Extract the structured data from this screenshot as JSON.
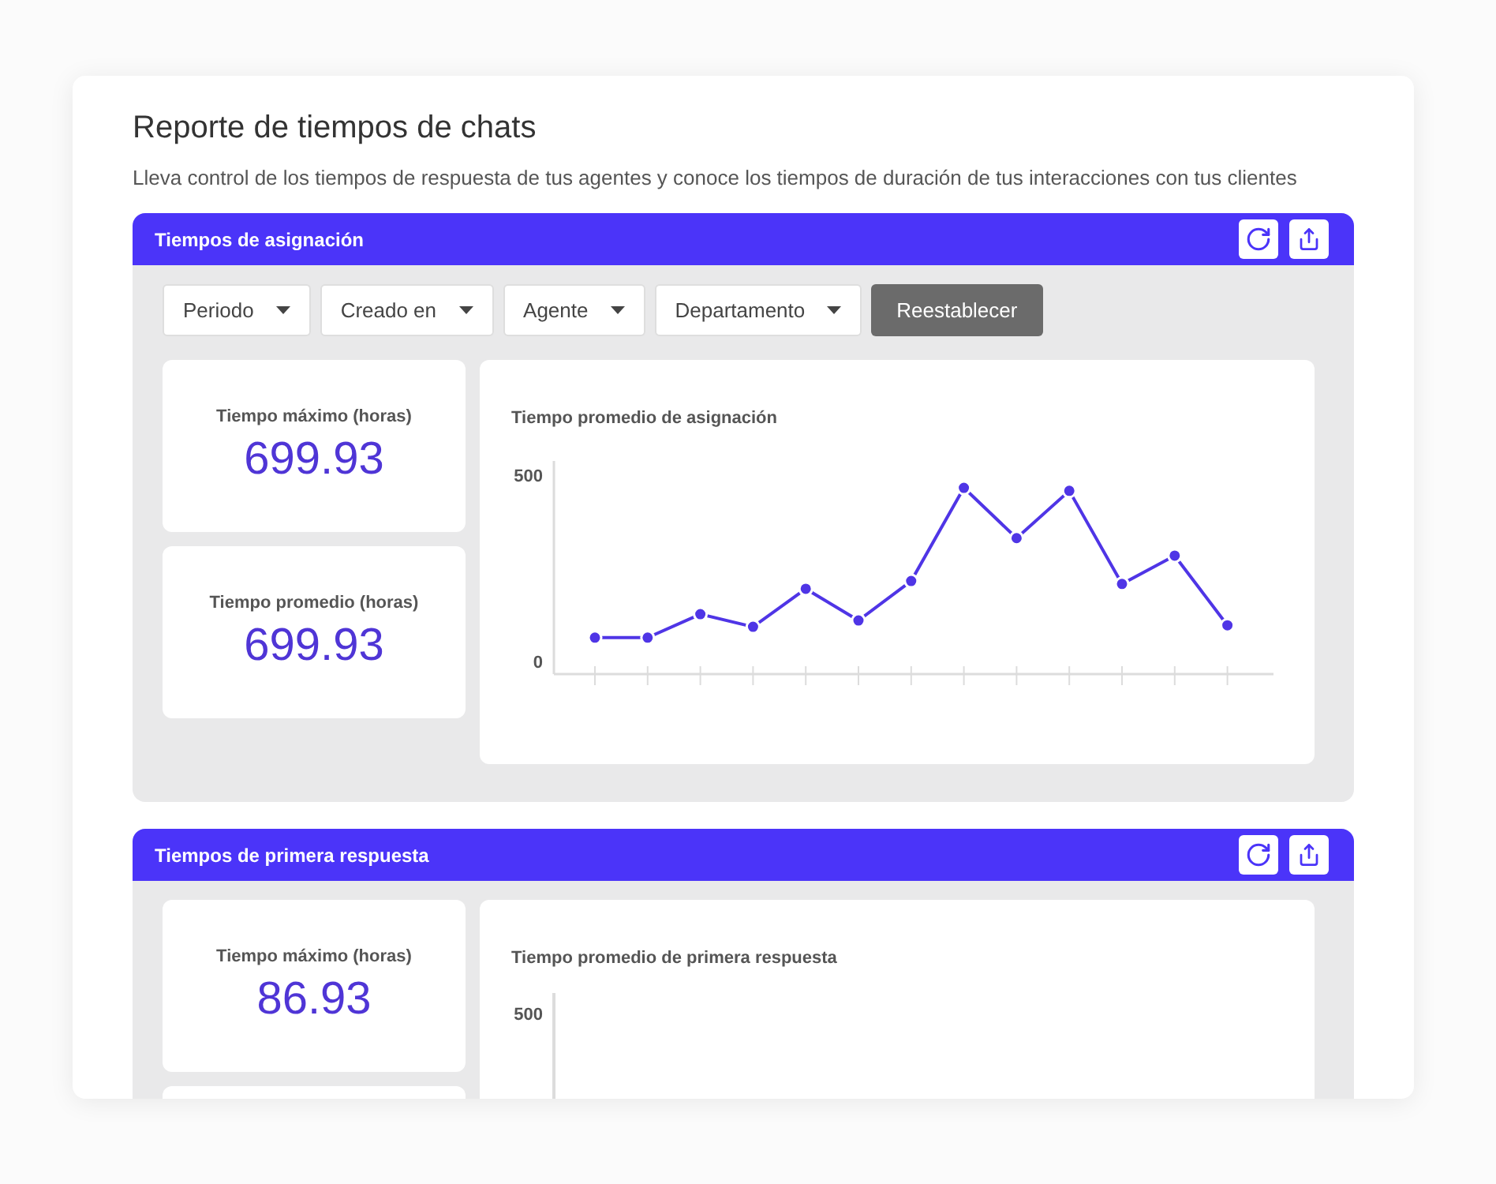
{
  "header": {
    "title": "Reporte de tiempos de chats",
    "description": "Lleva control de los tiempos de respuesta de tus agentes y conoce los tiempos de duración de tus interacciones con tus clientes"
  },
  "sections": [
    {
      "title": "Tiempos de asignación",
      "filters": [
        "Periodo",
        "Creado en",
        "Agente",
        "Departamento"
      ],
      "reset_button": "Reestablecer",
      "stats": [
        {
          "label": "Tiempo máximo (horas)",
          "value": "699.93"
        },
        {
          "label": "Tiempo promedio (horas)",
          "value": "699.93"
        }
      ],
      "chart": {
        "chart_data": {
          "type": "line",
          "title": "Tiempo promedio de asignación",
          "yticks": [
            0,
            500
          ],
          "ylim": [
            -34,
            538
          ],
          "series": [
            {
              "color": "#4f35e6",
              "marker": "circle",
              "values": [
                64,
                64,
                127,
                93,
                195,
                110,
                216,
                466,
                331,
                458,
                208,
                284,
                97
              ]
            }
          ]
        }
      }
    },
    {
      "title": "Tiempos de primera respuesta",
      "stats": [
        {
          "label": "Tiempo máximo (horas)",
          "value": "86.93"
        }
      ],
      "chart": {
        "title": "Tiempo promedio de primera respuesta",
        "axis_label": "500"
      }
    }
  ]
}
